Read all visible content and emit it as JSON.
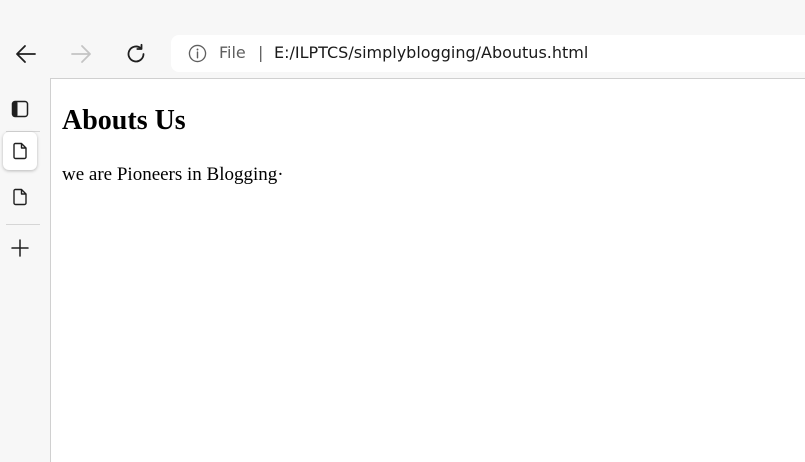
{
  "browser": {
    "nav": {
      "back_icon": "arrow-left-icon",
      "forward_icon": "arrow-right-icon",
      "reload_icon": "reload-icon"
    },
    "address_bar": {
      "info_icon": "info-icon",
      "scheme_label": "File",
      "separator": "|",
      "url": "E:/ILPTCS/simplyblogging/Aboutus.html"
    },
    "sidebar": {
      "items": [
        {
          "icon": "tab-actions-icon"
        },
        {
          "icon": "page-icon",
          "active": true
        },
        {
          "icon": "page-icon",
          "active": false
        },
        {
          "icon": "plus-icon"
        }
      ]
    }
  },
  "page": {
    "heading": "Abouts Us",
    "paragraph": "we are Pioneers in Blogging·"
  }
}
